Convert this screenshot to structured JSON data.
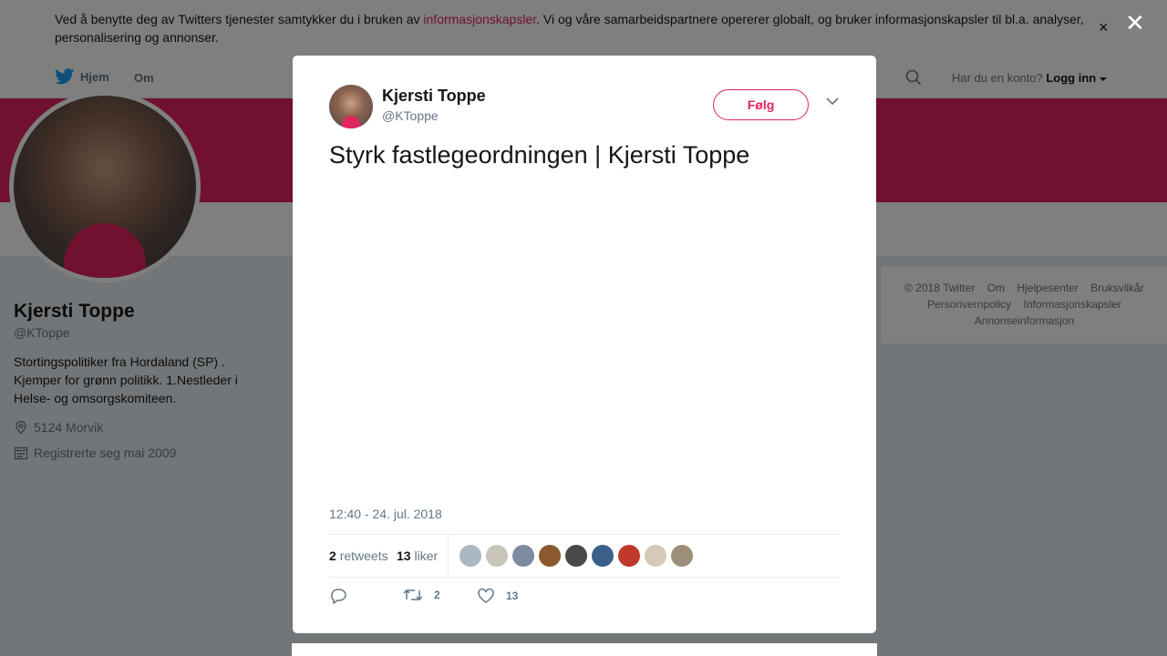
{
  "cookie_banner": {
    "text_before": "Ved å benytte deg av Twitters tjenester samtykker du i bruken av ",
    "link": "informasjonskapsler",
    "text_after": ". Vi og våre samarbeidspartnere opererer globalt, og bruker informasjonskapsler til bl.a. analyser, personalisering og annonser.",
    "close": "×"
  },
  "nav": {
    "home": "Hjem",
    "about": "Om",
    "have_account": "Har du en konto?",
    "login": "Logg inn"
  },
  "profile": {
    "name": "Kjersti Toppe",
    "handle": "@KToppe",
    "bio": "Stortingspolitiker fra Hordaland (SP) . Kjemper for grønn politikk. 1.Nestleder i Helse- og omsorgskomiteen.",
    "location": "5124 Morvik",
    "joined": "Registrerte seg mai 2009"
  },
  "footer": {
    "links": [
      "© 2018 Twitter",
      "Om",
      "Hjelpesenter",
      "Bruksvilkår",
      "Personvernpolicy",
      "Informasjonskapsler",
      "Annonseinformasjon"
    ]
  },
  "overlay": {
    "close": "✕"
  },
  "tweet": {
    "author_name": "Kjersti Toppe",
    "author_handle": "@KToppe",
    "follow_label": "Følg",
    "text": "Styrk fastlegeordningen | Kjersti Toppe",
    "timestamp": "12:40 - 24. jul. 2018",
    "retweet_count": "2",
    "retweet_label": "retweets",
    "like_count": "13",
    "like_label": "liker",
    "action_retweets": "2",
    "action_likes": "13"
  },
  "colors": {
    "accent": "#e0245e",
    "text": "#14171a",
    "muted": "#657786"
  }
}
